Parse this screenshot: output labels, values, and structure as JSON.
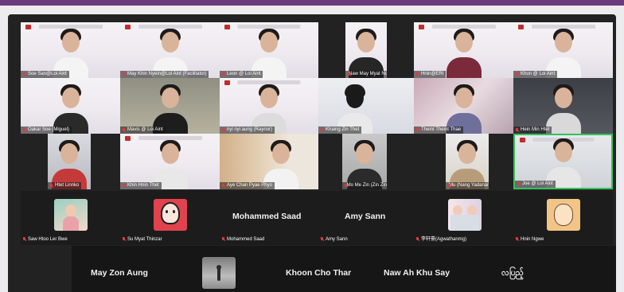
{
  "app": {
    "accent": "#6c3b7b",
    "active_speaker_color": "#35c15c",
    "mute_color": "#e23b3b"
  },
  "video_tiles": [
    {
      "id": "soe-san",
      "name": "Soe San@Loi Aint"
    },
    {
      "id": "may-khin",
      "name": "May Khin Nyein@Loi Aint (Facilitator)"
    },
    {
      "id": "leon",
      "name": "Leon @ Loi Aint"
    },
    {
      "id": "naw-may",
      "name": "Naw May Myat Noe"
    },
    {
      "id": "hnin",
      "name": "Hnin@ERI"
    },
    {
      "id": "khun",
      "name": "Khun @ Loi Aint"
    },
    {
      "id": "oakar-soe",
      "name": "Oakar Soe (Miguel)"
    },
    {
      "id": "mavis",
      "name": "Mavis @ Loi Aint"
    },
    {
      "id": "nyi-nyi",
      "name": "nyi nyi aung (Raynor)"
    },
    {
      "id": "khaing-zin",
      "name": "Khaing Zin Thet"
    },
    {
      "id": "theint",
      "name": "Theint Theint Thae"
    },
    {
      "id": "hein-min",
      "name": "Hein Min Htet"
    },
    {
      "id": "htet-linnko",
      "name": "Htet Linnko"
    },
    {
      "id": "khin-hnin",
      "name": "Khin Hnin Thet"
    },
    {
      "id": "aye-chan",
      "name": "Aye Chan Pyae Phyo"
    },
    {
      "id": "mo-me",
      "name": "Mo Me Zin (Zin Zin)"
    },
    {
      "id": "mu-nang",
      "name": "Mu (Nang Yadanar Soe)"
    },
    {
      "id": "joe",
      "name": "Joe @ Loi Aint"
    }
  ],
  "avatar_row": [
    {
      "id": "saw-htoo",
      "name": "Saw Htoo Ler Bwe"
    },
    {
      "id": "su-myat",
      "name": "Su Myat Thinzar"
    },
    {
      "id": "mohammed",
      "name": "Mohammed Saad",
      "big": "Mohammed Saad"
    },
    {
      "id": "amy",
      "name": "Amy Sann",
      "big": "Amy Sann"
    },
    {
      "id": "agwathanmg",
      "name": "李轩豪(Agwathanmg)"
    },
    {
      "id": "hnin-ngwe",
      "name": "Hnin Ngwe"
    }
  ],
  "bottom_row": [
    {
      "id": "may-zon",
      "big": "May Zon Aung"
    },
    {
      "id": "image-tile"
    },
    {
      "id": "khoon",
      "big": "Khoon Cho Thar"
    },
    {
      "id": "naw-ah-khu",
      "big": "Naw Ah Khu Say"
    },
    {
      "id": "burmese",
      "big": "လပြည့်"
    }
  ]
}
